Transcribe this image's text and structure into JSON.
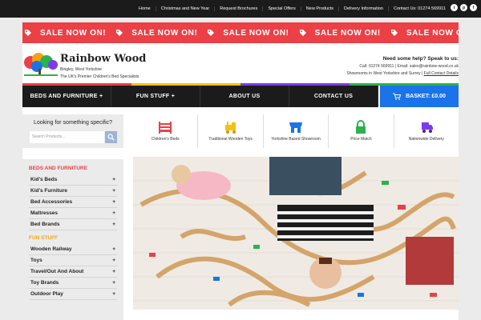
{
  "topnav": [
    "Home",
    "Christmas and New Year",
    "Request Brochures",
    "Special Offers",
    "New Products",
    "Delivery Information",
    "Contact Us: 01274 569911"
  ],
  "social": [
    "twitter-icon",
    "pinterest-icon",
    "facebook-icon"
  ],
  "sale_banner": {
    "text": "SALE NOW ON!",
    "color": "#ea4046"
  },
  "brand": {
    "name": "Rainbow Wood",
    "location": "Bingley, West Yorkshire",
    "tagline": "The UK's Premier Children's Bed Specialists"
  },
  "contact": {
    "help": "Need some help? Speak to us:",
    "phone": "Call: 01274 569911 | Email: sales@rainbow-wood.co.uk",
    "showrooms": "Showrooms in West Yorkshire and Surrey |",
    "details_link": "Full Contact Details"
  },
  "colors": {
    "accent_red": "#ea4046",
    "basket_blue": "#1a73e8",
    "nav_dark": "#1b1b1b",
    "rainbow": [
      "#ea4046",
      "#f4c10d",
      "#7c3aed",
      "#2bb24c"
    ]
  },
  "mainnav": [
    "BEDS AND FURNITURE +",
    "FUN STUFF +",
    "ABOUT US",
    "CONTACT US"
  ],
  "basket": {
    "label": "BASKET: £0.00",
    "icon": "cart-icon"
  },
  "search": {
    "prompt": "Looking for something specific?",
    "placeholder": "Search Products..."
  },
  "features": [
    {
      "label": "Children's Beds",
      "icon": "bed-icon"
    },
    {
      "label": "Traditional Wooden Toys",
      "icon": "train-icon"
    },
    {
      "label": "Yorkshire Based Showroom",
      "icon": "shop-icon"
    },
    {
      "label": "Price Match",
      "icon": "lock-icon"
    },
    {
      "label": "Nationwide Delivery",
      "icon": "truck-icon"
    }
  ],
  "sidebar": {
    "heading1": "BEDS AND FURNITURE",
    "items1": [
      "Kid's Beds",
      "Kid's Furniture",
      "Bed Accessories",
      "Mattresses",
      "Bed Brands"
    ],
    "heading2": "FUN STUFF",
    "items2": [
      "Wooden Railway",
      "Toys",
      "Travel/Out And About",
      "Toy Brands",
      "Outdoor Play"
    ]
  },
  "hero": {
    "description_icon": "hero-photo"
  }
}
